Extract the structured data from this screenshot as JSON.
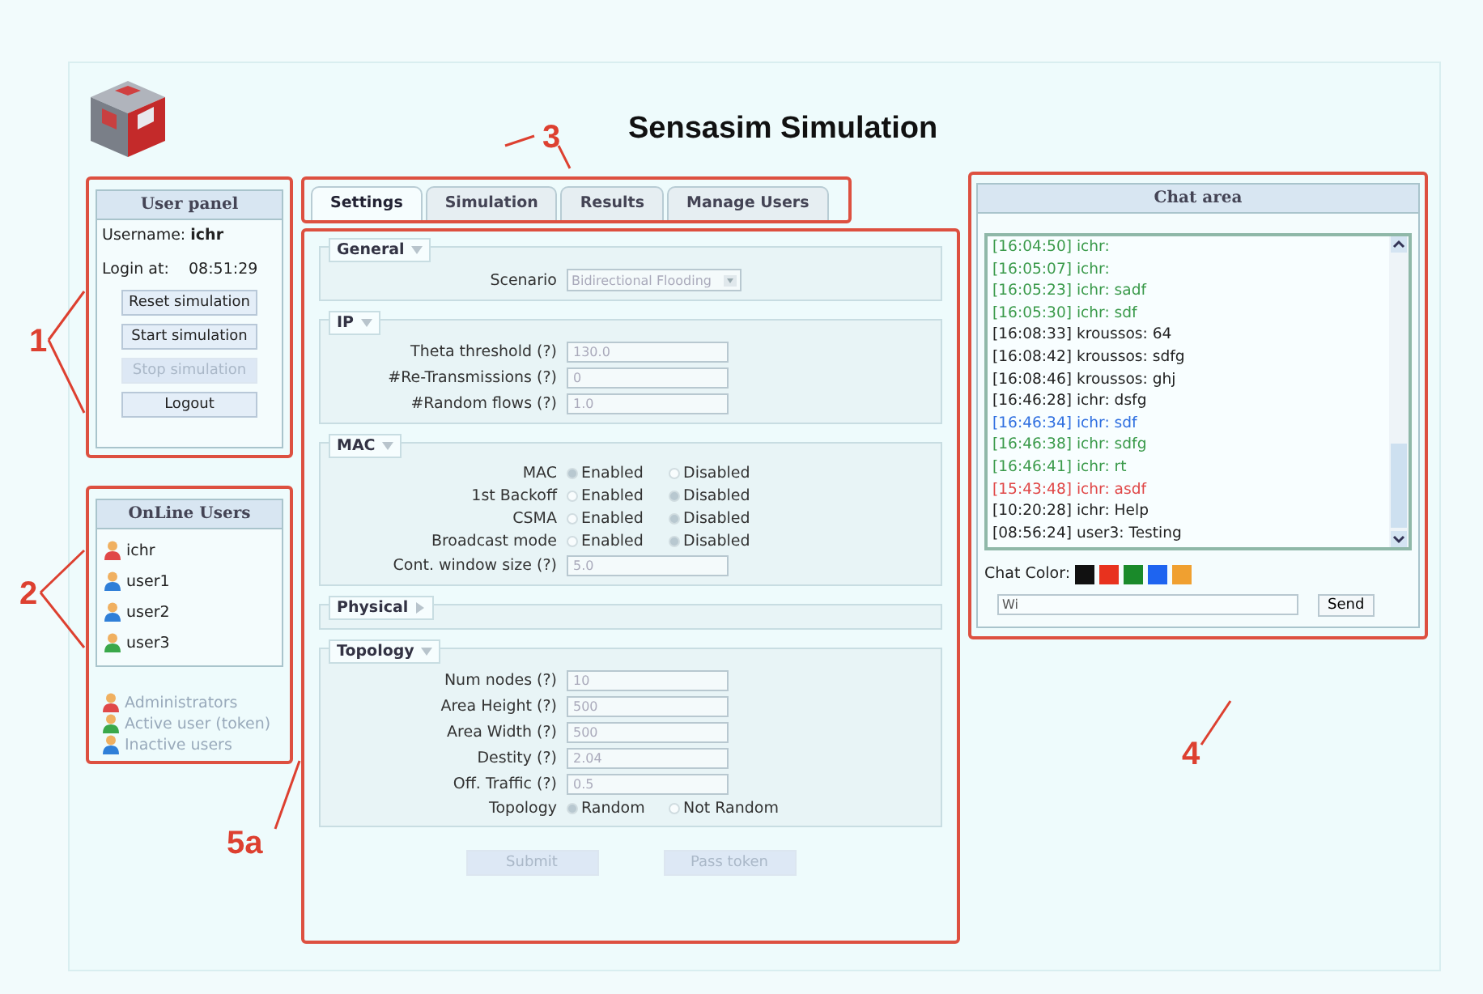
{
  "title": "Sensasim Simulation",
  "user_panel": {
    "heading": "User panel",
    "username_label": "Username:",
    "username": "ichr",
    "login_label": "Login at:",
    "login_time": "08:51:29",
    "buttons": [
      {
        "label": "Reset simulation",
        "disabled": false
      },
      {
        "label": "Start simulation",
        "disabled": false
      },
      {
        "label": "Stop simulation",
        "disabled": true
      },
      {
        "label": "Logout",
        "disabled": false
      }
    ]
  },
  "online_users": {
    "heading": "OnLine Users",
    "users": [
      {
        "name": "ichr",
        "color": "#e04848"
      },
      {
        "name": "user1",
        "color": "#2f7fd8"
      },
      {
        "name": "user2",
        "color": "#2f7fd8"
      },
      {
        "name": "user3",
        "color": "#3aa84a"
      }
    ],
    "legend": [
      {
        "label": "Administrators",
        "color": "#e04848"
      },
      {
        "label": "Active user (token)",
        "color": "#3aa84a"
      },
      {
        "label": "Inactive users",
        "color": "#2f7fd8"
      }
    ]
  },
  "tabs": [
    {
      "label": "Settings",
      "selected": true
    },
    {
      "label": "Simulation",
      "selected": false
    },
    {
      "label": "Results",
      "selected": false
    },
    {
      "label": "Manage Users",
      "selected": false
    }
  ],
  "sections": [
    {
      "title": "General",
      "expanded": true,
      "rows": [
        {
          "kind": "select",
          "label": "Scenario",
          "value": "Bidirectional Flooding"
        }
      ]
    },
    {
      "title": "IP",
      "expanded": true,
      "rows": [
        {
          "kind": "text",
          "label": "Theta threshold (?)",
          "value": "130.0"
        },
        {
          "kind": "text",
          "label": "#Re-Transmissions (?)",
          "value": "0"
        },
        {
          "kind": "text",
          "label": "#Random flows (?)",
          "value": "1.0"
        }
      ]
    },
    {
      "title": "MAC",
      "expanded": true,
      "rows": [
        {
          "kind": "radio",
          "label": "MAC",
          "options": [
            {
              "label": "Enabled",
              "selected": true
            },
            {
              "label": "Disabled",
              "selected": false
            }
          ]
        },
        {
          "kind": "radio",
          "label": "1st Backoff",
          "options": [
            {
              "label": "Enabled",
              "selected": false
            },
            {
              "label": "Disabled",
              "selected": true
            }
          ]
        },
        {
          "kind": "radio",
          "label": "CSMA",
          "options": [
            {
              "label": "Enabled",
              "selected": false
            },
            {
              "label": "Disabled",
              "selected": true
            }
          ]
        },
        {
          "kind": "radio",
          "label": "Broadcast mode",
          "options": [
            {
              "label": "Enabled",
              "selected": false
            },
            {
              "label": "Disabled",
              "selected": true
            }
          ]
        },
        {
          "kind": "text",
          "label": "Cont. window size (?)",
          "value": "5.0"
        }
      ]
    },
    {
      "title": "Physical",
      "expanded": false
    },
    {
      "title": "Topology",
      "expanded": true,
      "rows": [
        {
          "kind": "text",
          "label": "Num nodes (?)",
          "value": "10"
        },
        {
          "kind": "text",
          "label": "Area Height (?)",
          "value": "500"
        },
        {
          "kind": "text",
          "label": "Area Width (?)",
          "value": "500"
        },
        {
          "kind": "text",
          "label": "Destity (?)",
          "value": "2.04"
        },
        {
          "kind": "text",
          "label": "Off. Traffic (?)",
          "value": "0.5"
        },
        {
          "kind": "radio",
          "label": "Topology",
          "options": [
            {
              "label": "Random",
              "selected": true
            },
            {
              "label": "Not Random",
              "selected": false
            }
          ]
        }
      ]
    }
  ],
  "form_buttons": [
    {
      "label": "Submit",
      "disabled": true
    },
    {
      "label": "Pass token",
      "disabled": true
    }
  ],
  "chat": {
    "heading": "Chat area",
    "messages": [
      {
        "text": "[16:04:50] ichr:",
        "color": "#3a9a4a"
      },
      {
        "text": "[16:05:07] ichr:",
        "color": "#3a9a4a"
      },
      {
        "text": "[16:05:23] ichr: sadf",
        "color": "#3a9a4a"
      },
      {
        "text": "[16:05:30] ichr: sdf",
        "color": "#3a9a4a"
      },
      {
        "text": "[16:08:33] kroussos: 64",
        "color": "#222222"
      },
      {
        "text": "[16:08:42] kroussos: sdfg",
        "color": "#222222"
      },
      {
        "text": "[16:08:46] kroussos: ghj",
        "color": "#222222"
      },
      {
        "text": "[16:46:28] ichr: dsfg",
        "color": "#222222"
      },
      {
        "text": "[16:46:34] ichr: sdf",
        "color": "#2f6fe0"
      },
      {
        "text": "[16:46:38] ichr: sdfg",
        "color": "#3a9a4a"
      },
      {
        "text": "[16:46:41] ichr: rt",
        "color": "#3a9a4a"
      },
      {
        "text": "[15:43:48] ichr: asdf",
        "color": "#e04848"
      },
      {
        "text": "[10:20:28] ichr: Help",
        "color": "#222222"
      },
      {
        "text": "[08:56:24] user3: Testing",
        "color": "#222222"
      }
    ],
    "color_label": "Chat Color:",
    "swatches": [
      {
        "color": "#111111"
      },
      {
        "color": "#e8321e"
      },
      {
        "color": "#1a8a2a"
      },
      {
        "color": "#1e64f0"
      },
      {
        "color": "#f0a030"
      }
    ],
    "input": "Wi",
    "send": "Send"
  },
  "annotations": [
    {
      "label": "1"
    },
    {
      "label": "2"
    },
    {
      "label": "3"
    },
    {
      "label": "4"
    },
    {
      "label": "5a"
    }
  ]
}
